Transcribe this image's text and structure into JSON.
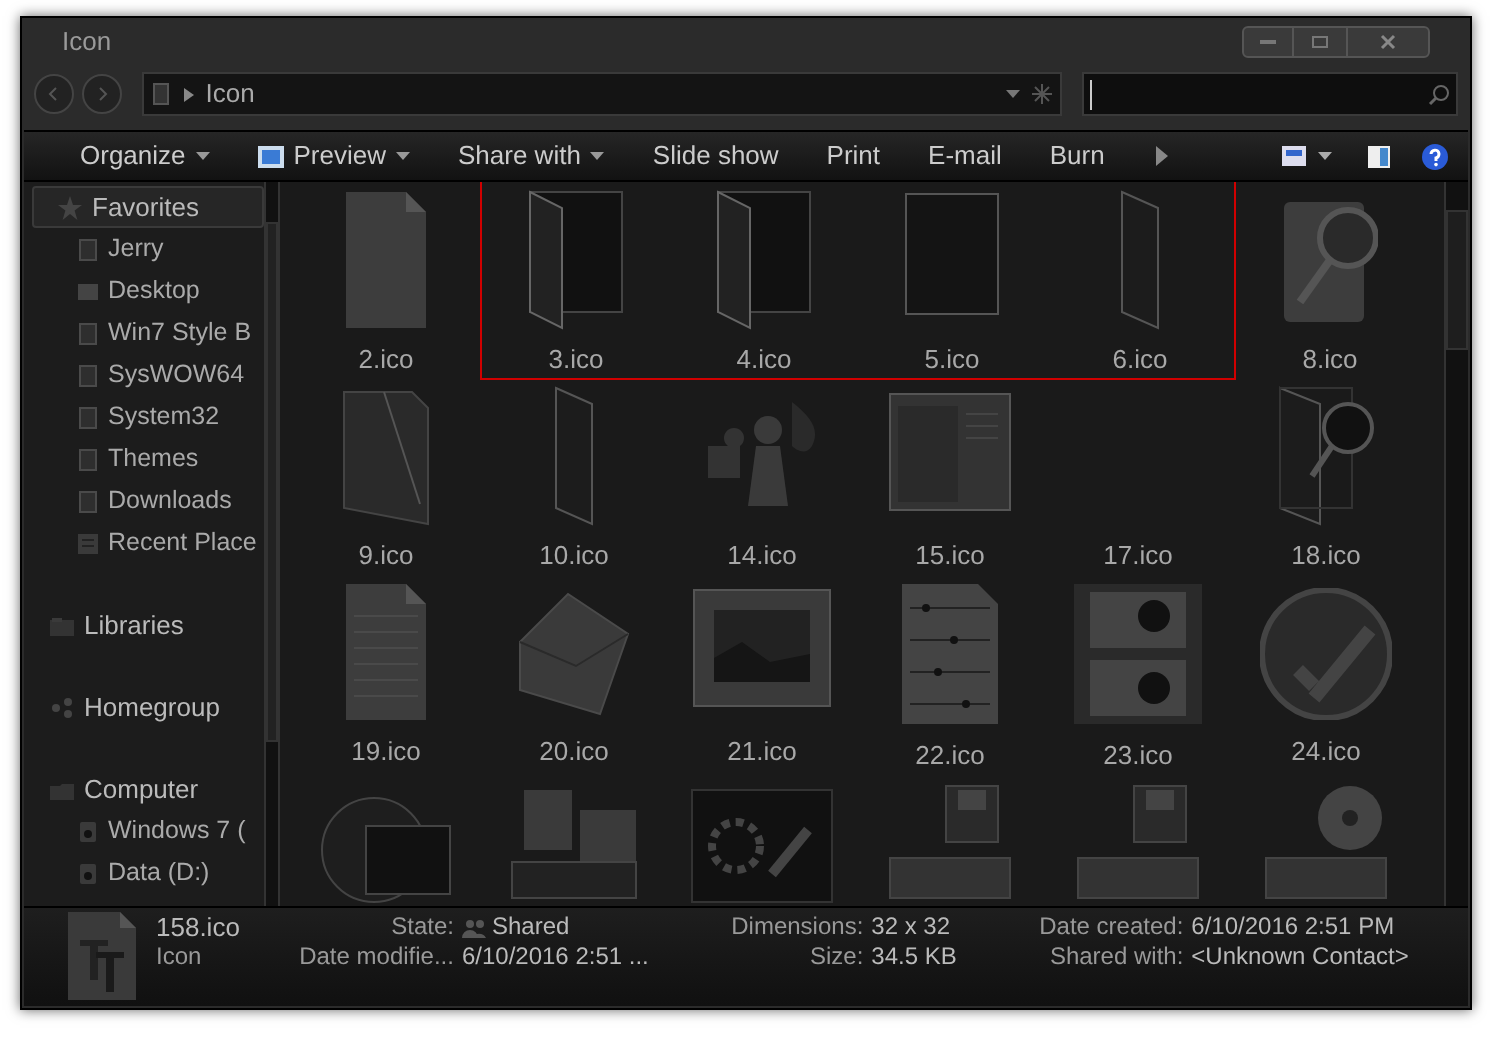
{
  "window": {
    "title": "Icon"
  },
  "address": {
    "path": "Icon"
  },
  "toolbar": [
    {
      "label": "Organize",
      "dropdown": true,
      "kind": "plain"
    },
    {
      "label": "Preview",
      "dropdown": true,
      "kind": "preview"
    },
    {
      "label": "Share with",
      "dropdown": true,
      "kind": "plain"
    },
    {
      "label": "Slide show",
      "dropdown": false,
      "kind": "plain"
    },
    {
      "label": "Print",
      "dropdown": false,
      "kind": "plain"
    },
    {
      "label": "E-mail",
      "dropdown": false,
      "kind": "plain"
    },
    {
      "label": "Burn",
      "dropdown": false,
      "kind": "plain"
    }
  ],
  "sidebar": {
    "groups": [
      {
        "label": "Favorites",
        "kind": "star",
        "selected": true,
        "children": [
          {
            "label": "Jerry",
            "kind": "folder"
          },
          {
            "label": "Desktop",
            "kind": "desktop"
          },
          {
            "label": "Win7 Style B",
            "kind": "folder"
          },
          {
            "label": "SysWOW64",
            "kind": "folder"
          },
          {
            "label": "System32",
            "kind": "folder"
          },
          {
            "label": "Themes",
            "kind": "folder"
          },
          {
            "label": "Downloads",
            "kind": "folder"
          },
          {
            "label": "Recent Place",
            "kind": "recent"
          }
        ]
      },
      {
        "label": "Libraries",
        "kind": "library",
        "selected": false
      },
      {
        "label": "Homegroup",
        "kind": "homegroup",
        "selected": false
      },
      {
        "label": "Computer",
        "kind": "computer",
        "selected": false,
        "children": [
          {
            "label": "Windows 7 (",
            "kind": "drive"
          },
          {
            "label": "Data (D:)",
            "kind": "drive"
          }
        ]
      }
    ]
  },
  "files": [
    [
      {
        "label": "2.ico",
        "kind": "page",
        "highlighted": false
      },
      {
        "label": "3.ico",
        "kind": "open-folder",
        "highlighted": true
      },
      {
        "label": "4.ico",
        "kind": "open-folder",
        "highlighted": true
      },
      {
        "label": "5.ico",
        "kind": "panel",
        "highlighted": true
      },
      {
        "label": "6.ico",
        "kind": "slim-folder",
        "highlighted": true
      },
      {
        "label": "8.ico",
        "kind": "search-stack",
        "highlighted": false
      }
    ],
    [
      {
        "label": "9.ico",
        "kind": "folder",
        "highlighted": false
      },
      {
        "label": "10.ico",
        "kind": "slim-folder",
        "highlighted": false
      },
      {
        "label": "14.ico",
        "kind": "chess",
        "highlighted": false
      },
      {
        "label": "15.ico",
        "kind": "window",
        "highlighted": false
      },
      {
        "label": "17.ico",
        "kind": "none",
        "highlighted": false
      },
      {
        "label": "18.ico",
        "kind": "search-folder",
        "highlighted": false
      }
    ],
    [
      {
        "label": "19.ico",
        "kind": "lined-page",
        "highlighted": false
      },
      {
        "label": "20.ico",
        "kind": "envelope",
        "highlighted": false
      },
      {
        "label": "21.ico",
        "kind": "picture",
        "highlighted": false
      },
      {
        "label": "22.ico",
        "kind": "music",
        "highlighted": false
      },
      {
        "label": "23.ico",
        "kind": "film",
        "highlighted": false
      },
      {
        "label": "24.ico",
        "kind": "check-disc",
        "highlighted": false
      }
    ],
    [
      {
        "kind": "monitor",
        "highlighted": false
      },
      {
        "kind": "printer",
        "highlighted": false
      },
      {
        "kind": "gear",
        "highlighted": false
      },
      {
        "kind": "floppy-drive",
        "highlighted": false
      },
      {
        "kind": "floppy-drive",
        "highlighted": false
      },
      {
        "kind": "disc-drive",
        "highlighted": false
      }
    ]
  ],
  "details": {
    "name": "158.ico",
    "type": "Icon",
    "fields": [
      [
        {
          "label": "State:",
          "value": "Shared",
          "kind": "shared"
        },
        {
          "label": "Date modifie...",
          "value": "6/10/2016 2:51 ...",
          "kind": "plain"
        }
      ],
      [
        {
          "label": "Dimensions:",
          "value": "32 x 32",
          "kind": "plain"
        },
        {
          "label": "Size:",
          "value": "34.5 KB",
          "kind": "plain"
        }
      ],
      [
        {
          "label": "Date created:",
          "value": "6/10/2016 2:51 PM",
          "kind": "plain"
        },
        {
          "label": "Shared with:",
          "value": "<Unknown Contact>",
          "kind": "plain"
        }
      ]
    ]
  }
}
